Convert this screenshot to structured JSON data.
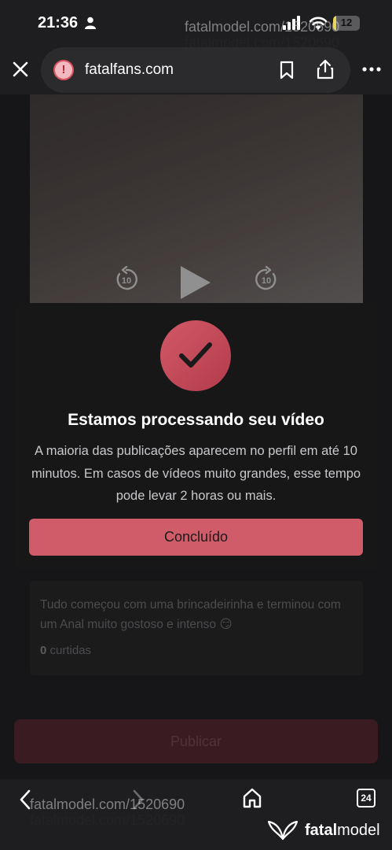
{
  "status_bar": {
    "time": "21:36",
    "battery_level": 12,
    "battery_text": "12",
    "battery_color": "#e8d84a"
  },
  "browser": {
    "url": "fatalfans.com"
  },
  "video": {
    "rewind_label": "10",
    "forward_label": "10"
  },
  "post": {
    "caption": "Tudo começou com uma brincadeirinha e terminou com um Anal muito gostoso e intenso 😏",
    "likes_count": "0",
    "likes_label": "curtidas",
    "publish_label": "Publicar"
  },
  "modal": {
    "title": "Estamos processando seu vídeo",
    "message": "A maioria das publicações aparecem no perfil em até 10 minutos. Em casos de vídeos muito grandes, esse tempo pode levar 2 horas ou mais.",
    "button_label": "Concluído",
    "accent_color": "#d05c6a"
  },
  "toolbar": {
    "tabs_count": "24"
  },
  "watermarks": {
    "top_line_1": "fatalmodel.com/1520690",
    "top_line_2": "fatalmodel.com/1520690",
    "bottom_line_1": "fatalmodel.com/1520690",
    "bottom_line_2": "fatalmodel.com/1520690",
    "brand_prefix": "fatal",
    "brand_suffix": "model"
  }
}
